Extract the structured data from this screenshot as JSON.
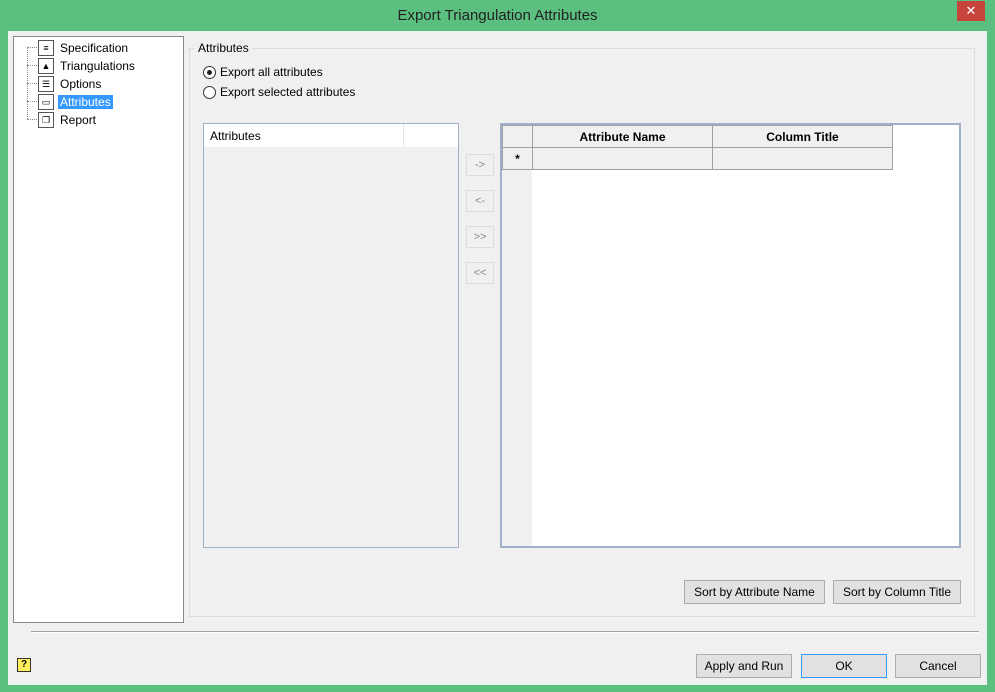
{
  "window": {
    "title": "Export Triangulation Attributes",
    "close": "✕"
  },
  "tree": {
    "items": [
      {
        "label": "Specification",
        "icon": "specification-icon",
        "glyph": "≡"
      },
      {
        "label": "Triangulations",
        "icon": "triangle-icon",
        "glyph": "▲"
      },
      {
        "label": "Options",
        "icon": "options-list-icon",
        "glyph": "☰"
      },
      {
        "label": "Attributes",
        "icon": "comment-icon",
        "glyph": "▭",
        "selected": true
      },
      {
        "label": "Report",
        "icon": "report-icon",
        "glyph": "❐"
      }
    ]
  },
  "group": {
    "label": "Attributes",
    "radio_all": "Export all attributes",
    "radio_selected": "Export selected attributes",
    "selected": "all"
  },
  "list": {
    "header": "Attributes"
  },
  "move": {
    "right": "->",
    "left": "<-",
    "all_right": ">>",
    "all_left": "<<"
  },
  "grid": {
    "columns": [
      "Attribute Name",
      "Column Title"
    ],
    "new_row_marker": "*"
  },
  "sort": {
    "by_name": "Sort by Attribute Name",
    "by_title": "Sort by Column Title"
  },
  "footer": {
    "help": "?",
    "apply": "Apply and Run",
    "ok": "OK",
    "cancel": "Cancel"
  }
}
